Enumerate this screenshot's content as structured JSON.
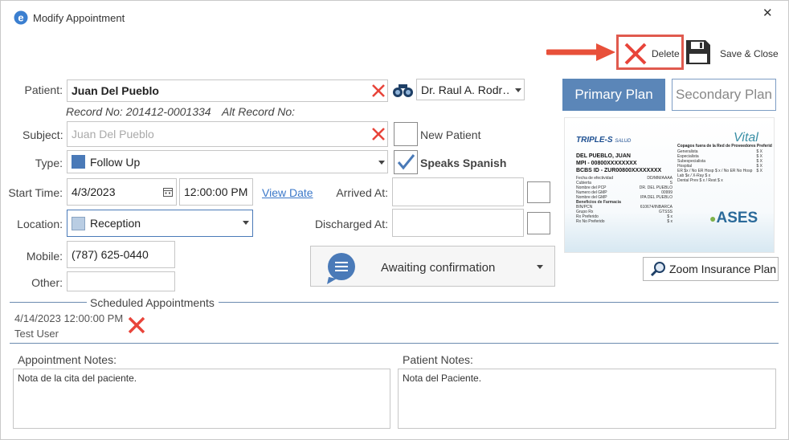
{
  "window": {
    "title": "Modify Appointment",
    "close_glyph": "✕"
  },
  "toolbar": {
    "delete_label": "Delete",
    "save_close_label": "Save & Close",
    "highlight_color": "#e74c3c"
  },
  "patient": {
    "label": "Patient:",
    "value": "Juan Del Pueblo",
    "record_no": "Record No: 201412-0001334",
    "alt_record_no": "Alt Record No:"
  },
  "doctor": {
    "value": "Dr. Raul A. Rodr…"
  },
  "subject": {
    "label": "Subject:",
    "placeholder": "Juan Del Pueblo"
  },
  "new_patient": {
    "label": "New Patient",
    "checked": false
  },
  "type": {
    "label": "Type:",
    "value": "Follow Up",
    "color": "#4a7ab8"
  },
  "speaks_spanish": {
    "label": "Speaks Spanish",
    "checked": true
  },
  "start_time": {
    "label": "Start Time:",
    "date": "4/3/2023",
    "time": "12:00:00 PM",
    "view_date_link": "View Date"
  },
  "arrived_at": {
    "label": "Arrived At:",
    "value": ""
  },
  "location": {
    "label": "Location:",
    "value": "Reception",
    "color": "#b9cde3"
  },
  "discharged_at": {
    "label": "Discharged At:",
    "value": ""
  },
  "mobile": {
    "label": "Mobile:",
    "value": "(787) 625-0440"
  },
  "other": {
    "label": "Other:",
    "value": ""
  },
  "status": {
    "value": "Awaiting confirmation",
    "icon_color": "#4a7ab8"
  },
  "plans": {
    "primary_label": "Primary Plan",
    "secondary_label": "Secondary Plan",
    "primary_color": "#5b86b8"
  },
  "insurance_card": {
    "brand": "TRIPLE-S",
    "brand_sub": "SALUD",
    "vital": "Vital",
    "ases": "ASES",
    "name": "DEL PUEBLO, JUAN",
    "mpi": "MPI - 00800XXXXXXXX",
    "bcbs": "BCBS ID - ZUR00800XXXXXXXX",
    "left_rows": [
      [
        "Fecha de efectividad",
        "DD/MM/AAAA"
      ],
      [
        "Cubierta",
        "S"
      ],
      [
        "Nombre del PCP",
        "DR. DEL PUEBLO"
      ],
      [
        "Numero del GMP",
        "00999"
      ],
      [
        "Nombre del GMP",
        "IPA DEL PUEBLO"
      ]
    ],
    "benefits_title": "Beneficios de Farmacia",
    "pharmacy_rows": [
      [
        "BIN/PCN",
        "610674/INBARCA"
      ],
      [
        "Grupo Rx",
        "GTSSS"
      ],
      [
        "Rx Preferido",
        "$ x"
      ],
      [
        "Rx No Preferido",
        "$ x"
      ]
    ],
    "copay_title": "Copagos fuera de la Red de Proveedores Preferidos",
    "right_rows": [
      [
        "Generalista",
        "$ X"
      ],
      [
        "Especialista",
        "$ X"
      ],
      [
        "Subespecialista",
        "$ X"
      ],
      [
        "Hospital",
        "$ X"
      ],
      [
        "ER $x / No ER Hosp $ x / No ER No Hosp",
        "$ X"
      ],
      [
        "Lab $x / X-Ray $ x",
        ""
      ],
      [
        "Dental Prev $ x / Rest $ x",
        ""
      ]
    ]
  },
  "zoom_insurance_label": "Zoom Insurance Plan",
  "scheduled": {
    "title": "Scheduled Appointments",
    "items": [
      {
        "datetime": "4/14/2023 12:00:00 PM",
        "user": "Test User"
      }
    ]
  },
  "notes": {
    "appointment_label": "Appointment Notes:",
    "appointment_value": "Nota de la cita del paciente.",
    "patient_label": "Patient Notes:",
    "patient_value": "Nota del Paciente."
  }
}
